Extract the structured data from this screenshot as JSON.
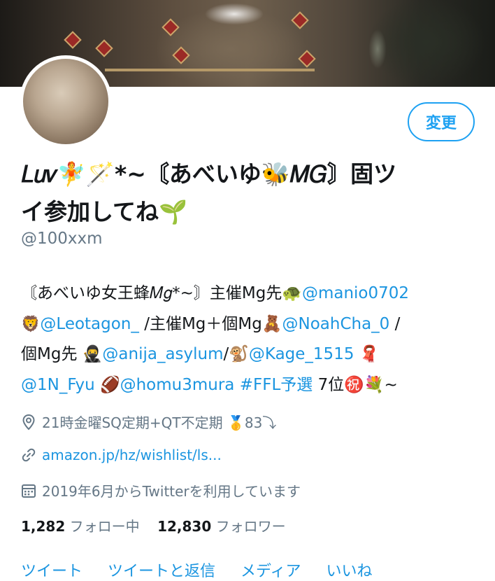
{
  "profile": {
    "name_line1": "𝐿𝑢𝑣🧚🪄*~〘あべいゆ🐝𝑀𝐺〙固ツ",
    "name_line2": "イ参加してね🌱",
    "handle": "@100xxm",
    "edit_button": "変更"
  },
  "bio": {
    "l1_a": "〘あべいゆ女王蜂𝑀𝑔*~〙主催Mg先🐢",
    "l1_mention": "@manio0702",
    "l2_emoji": "🦁",
    "l2_mention1": "@Leotagon_",
    "l2_text": " /主催Mg＋個Mg🧸",
    "l2_mention2": "@NoahCha_0",
    "l2_tail": " /",
    "l3_a": "個Mg先 🥷",
    "l3_mention1": "@anija_asylum",
    "l3_b": "/🐒",
    "l3_mention2": "@Kage_1515",
    "l3_emoji": " 🧣",
    "l4_mention1": "@1N_Fyu",
    "l4_emoji": " 🏈",
    "l4_mention2": "@homu3mura",
    "l4_hashtag": " #FFL予選",
    "l4_tail": " 7位㊗️💐~"
  },
  "meta": {
    "location": "21時金曜SQ定期+QT不定期 🥇83⤵",
    "link": "amazon.jp/hz/wishlist/ls...",
    "joined": "2019年6月からTwitterを利用しています"
  },
  "stats": {
    "following_count": "1,282",
    "following_label": "フォロー中",
    "followers_count": "12,830",
    "followers_label": "フォロワー"
  },
  "tabs": [
    "ツイート",
    "ツイートと返信",
    "メディア",
    "いいね"
  ],
  "colors": {
    "accent": "#1da1f2",
    "link": "#1b95e0",
    "muted": "#657786",
    "text": "#14171a"
  },
  "icons": {
    "location": "location-pin-icon",
    "link": "link-icon",
    "joined": "calendar-icon"
  }
}
